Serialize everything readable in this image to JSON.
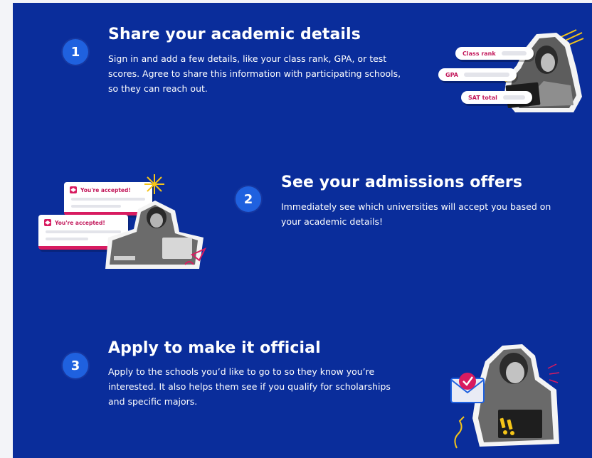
{
  "steps": [
    {
      "number": "1",
      "title": "Share your academic details",
      "description": "Sign in and add a few details, like your class rank, GPA, or test scores. Agree to share this information with participating schools, so they can reach out.",
      "illustration": {
        "pills": [
          "Class rank",
          "GPA",
          "SAT total"
        ]
      }
    },
    {
      "number": "2",
      "title": "See your admissions offers",
      "description": "Immediately see which universities will accept you based on your academic details!",
      "illustration": {
        "cards": [
          "You're accepted!",
          "You're accepted!"
        ]
      }
    },
    {
      "number": "3",
      "title": "Apply to make it official",
      "description": "Apply to the schools you’d like to go to so they know you’re interested. It also helps them see if you qualify for scholarships and specific majors."
    }
  ],
  "colors": {
    "background": "#0a2d9b",
    "badge": "#1f61df",
    "accent": "#d81b60"
  }
}
